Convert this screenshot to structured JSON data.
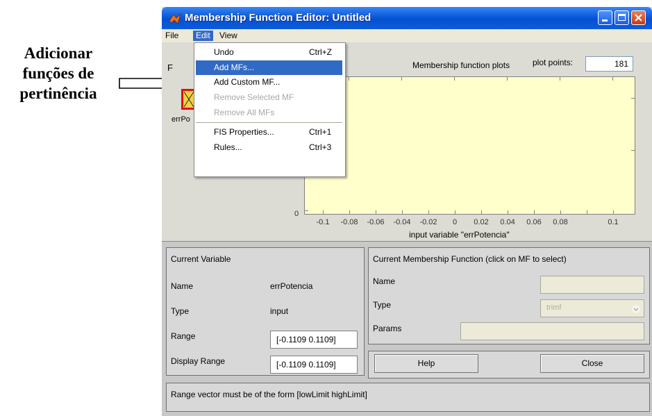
{
  "annotation": {
    "lines": [
      "Adicionar",
      "funções de",
      "pertinência"
    ]
  },
  "window": {
    "title": "Membership Function Editor: Untitled"
  },
  "menubar": {
    "file": "File",
    "edit": "Edit",
    "view": "View"
  },
  "edit_menu": {
    "items": [
      {
        "label": "Undo",
        "shortcut": "Ctrl+Z"
      },
      {
        "label": "Add MFs...",
        "shortcut": ""
      },
      {
        "label": "Add Custom MF...",
        "shortcut": ""
      },
      {
        "label": "Remove Selected MF",
        "shortcut": ""
      },
      {
        "label": "Remove All MFs",
        "shortcut": ""
      },
      {
        "label": "FIS Properties...",
        "shortcut": "Ctrl+1"
      },
      {
        "label": "Rules...",
        "shortcut": "Ctrl+3"
      }
    ]
  },
  "fis_panel": {
    "partial_label_top": "F",
    "partial_label_var": "errPo"
  },
  "plot": {
    "title": "Membership function plots",
    "plot_points_label": "plot points:",
    "plot_points_value": "181",
    "y_tick": "0",
    "x_ticks": [
      "-0.1",
      "-0.08",
      "-0.06",
      "-0.04",
      "-0.02",
      "0",
      "0.02",
      "0.04",
      "0.06",
      "0.08",
      "0.1"
    ],
    "x_label": "input variable \"errPotencia\""
  },
  "current_variable": {
    "header": "Current Variable",
    "name_label": "Name",
    "name_value": "errPotencia",
    "type_label": "Type",
    "type_value": "input",
    "range_label": "Range",
    "range_value": "[-0.1109 0.1109]",
    "display_range_label": "Display Range",
    "display_range_value": "[-0.1109 0.1109]"
  },
  "current_mf": {
    "header": "Current Membership Function (click on MF to select)",
    "name_label": "Name",
    "type_label": "Type",
    "type_value": "trimf",
    "params_label": "Params"
  },
  "buttons": {
    "help": "Help",
    "close": "Close"
  },
  "status": {
    "message": "Range vector must be of the form [lowLimit highLimit]"
  }
}
